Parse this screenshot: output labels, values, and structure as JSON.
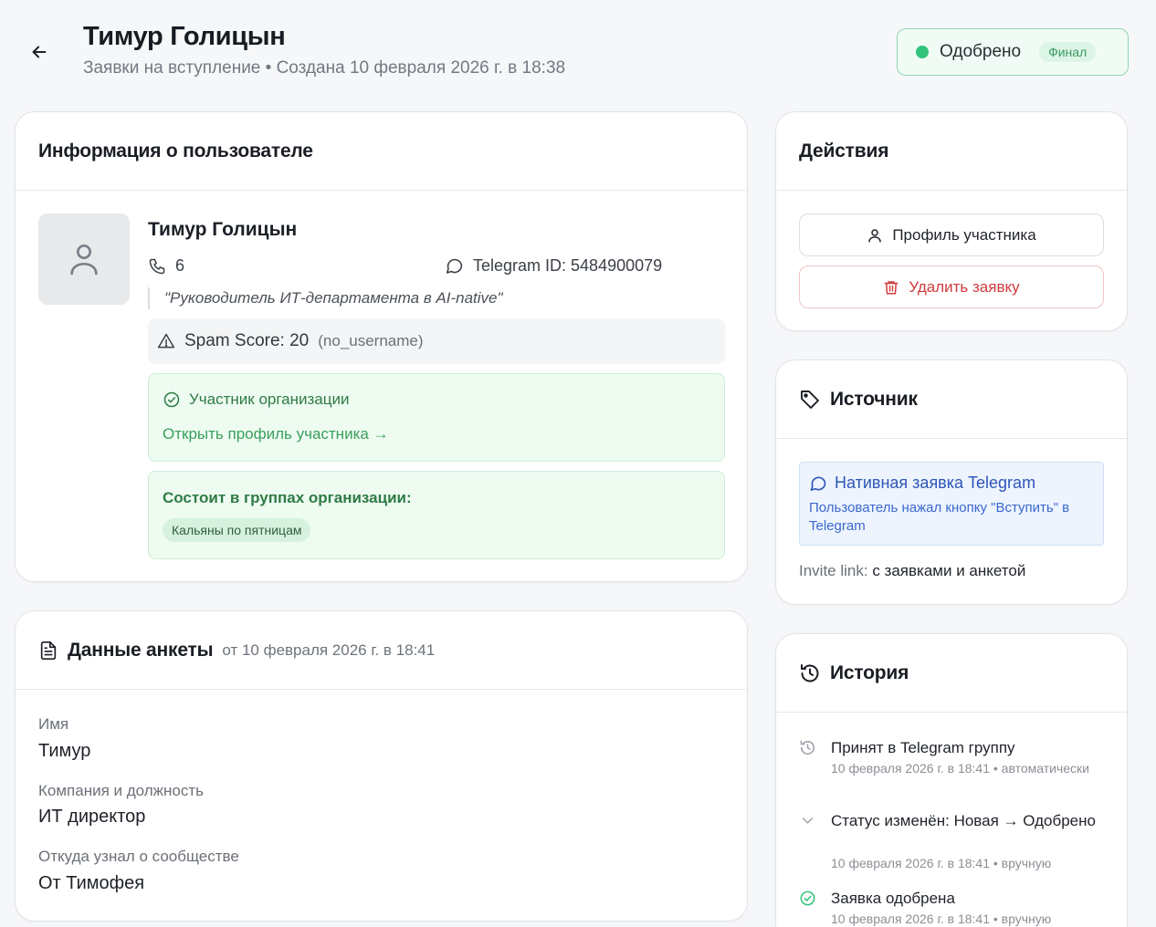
{
  "header": {
    "title": "Тимур Голицын",
    "subtitle": "Заявки на вступление • Создана 10 февраля 2026 г. в 18:38",
    "status": "Одобрено",
    "status_badge": "Финал"
  },
  "user_card": {
    "heading": "Информация о пользователе",
    "name": "Тимур Голицын",
    "phone": "6",
    "telegram": "Telegram ID: 5484900079",
    "bio": "\"Руководитель ИТ-департамента в AI-native\"",
    "spam_score": "Spam Score: 20",
    "spam_reason": "(no_username)",
    "member_title": "Участник организации",
    "member_link": "Открыть профиль участника →",
    "groups_title": "Состоит в группах организации:",
    "groups": [
      "Кальяны по пятницам"
    ]
  },
  "survey": {
    "heading": "Данные анкеты",
    "date": "от 10 февраля 2026 г. в 18:41",
    "fields": [
      {
        "label": "Имя",
        "value": "Тимур"
      },
      {
        "label": "Компания и должность",
        "value": "ИТ директор"
      },
      {
        "label": "Откуда узнал о сообществе",
        "value": "От Тимофея"
      }
    ]
  },
  "actions": {
    "heading": "Действия",
    "profile_button": "Профиль участника",
    "delete_button": "Удалить заявку"
  },
  "source": {
    "heading": "Источник",
    "type_title": "Нативная заявка Telegram",
    "type_desc": "Пользователь нажал кнопку \"Вступить\" в Telegram",
    "invite_label": "Invite link:",
    "invite_value": "с заявками и анкетой"
  },
  "history": {
    "heading": "История",
    "items": [
      {
        "icon": "history-icon",
        "text": "Принят в Telegram группу",
        "meta": "10 февраля 2026 г. в 18:41 • автоматически"
      },
      {
        "icon": "chevron-down-icon",
        "text": "Статус изменён: Новая → Одобрено",
        "meta": "10 февраля 2026 г. в 18:41 • вручную"
      },
      {
        "icon": "check-circle-icon",
        "text": "Заявка одобрена",
        "meta": "10 февраля 2026 г. в 18:41 • вручную"
      }
    ]
  },
  "colors": {
    "approved_green": "#33c47a",
    "danger_red": "#d13a3a",
    "link_blue": "#2d55b8"
  }
}
